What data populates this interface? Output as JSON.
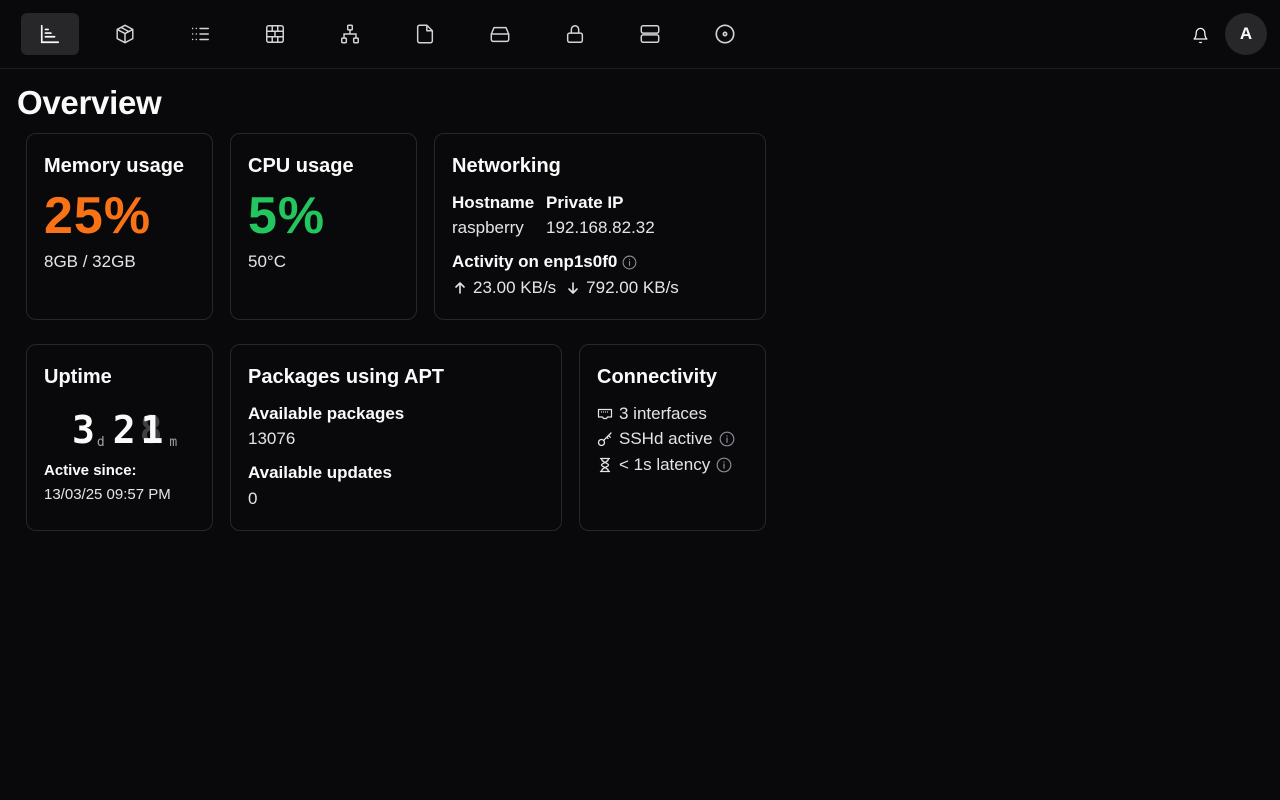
{
  "nav": {
    "items": [
      {
        "icon": "chart-icon",
        "active": true
      },
      {
        "icon": "package-icon",
        "active": false
      },
      {
        "icon": "list-icon",
        "active": false
      },
      {
        "icon": "firewall-icon",
        "active": false
      },
      {
        "icon": "network-icon",
        "active": false
      },
      {
        "icon": "file-icon",
        "active": false
      },
      {
        "icon": "drive-icon",
        "active": false
      },
      {
        "icon": "lock-icon",
        "active": false
      },
      {
        "icon": "server-icon",
        "active": false
      },
      {
        "icon": "disc-icon",
        "active": false
      }
    ],
    "avatar_initial": "A"
  },
  "page": {
    "title": "Overview"
  },
  "memory": {
    "title": "Memory usage",
    "percent": "25%",
    "detail": "8GB / 32GB",
    "color": "#f97316"
  },
  "cpu": {
    "title": "CPU usage",
    "percent": "5%",
    "detail": "50°C",
    "color": "#22c55e"
  },
  "networking": {
    "title": "Networking",
    "hostname_label": "Hostname",
    "hostname_value": "raspberry",
    "ip_label": "Private IP",
    "ip_value": "192.168.82.32",
    "activity_label": "Activity on enp1s0f0",
    "upload": "23.00 KB/s",
    "download": "792.00 KB/s"
  },
  "uptime": {
    "title": "Uptime",
    "days_digit": "3",
    "days_unit": "d",
    "minutes_ghost": "8",
    "minutes_tens": "2",
    "minutes_digit": "1",
    "minutes_unit": "m",
    "active_since_label": "Active since:",
    "active_since_value": "13/03/25 09:57 PM"
  },
  "packages": {
    "title": "Packages using APT",
    "available_label": "Available packages",
    "available_value": "13076",
    "updates_label": "Available updates",
    "updates_value": "0"
  },
  "connectivity": {
    "title": "Connectivity",
    "interfaces": "3 interfaces",
    "sshd": "SSHd active",
    "latency": "< 1s latency"
  }
}
